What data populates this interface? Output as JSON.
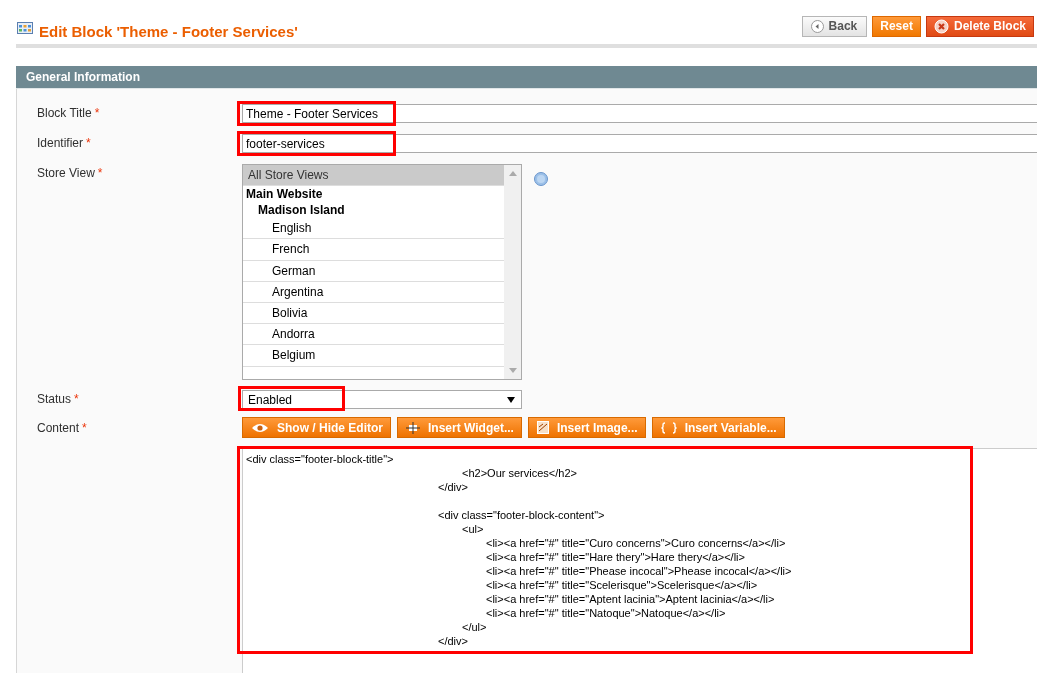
{
  "page_title": "Edit Block 'Theme - Footer Services'",
  "actions": [
    {
      "label": "Back",
      "kind": "back"
    },
    {
      "label": "Reset",
      "kind": "reset"
    },
    {
      "label": "Delete Block",
      "kind": "delete"
    }
  ],
  "section": {
    "title": "General Information"
  },
  "fields": [
    {
      "label": "Block Title",
      "required_mark": "*",
      "kind": "text",
      "value": "Theme - Footer Services",
      "highlighted": true
    },
    {
      "label": "Identifier",
      "required_mark": "*",
      "kind": "text",
      "value": "footer-services",
      "highlighted": true
    },
    {
      "label": "Store View",
      "required_mark": "*",
      "kind": "multiselect",
      "help": true,
      "options": [
        {
          "kind": "option",
          "label": "All Store Views",
          "selected": true
        },
        {
          "kind": "group",
          "label": "Main Website",
          "children": [
            {
              "kind": "group",
              "label": "Madison Island",
              "children": [
                {
                  "kind": "option",
                  "label": "English",
                  "selected": false
                },
                {
                  "kind": "option",
                  "label": "French",
                  "selected": false
                },
                {
                  "kind": "option",
                  "label": "German",
                  "selected": false
                },
                {
                  "kind": "option",
                  "label": "Argentina",
                  "selected": false
                },
                {
                  "kind": "option",
                  "label": "Bolivia",
                  "selected": false
                },
                {
                  "kind": "option",
                  "label": "Andorra",
                  "selected": false
                },
                {
                  "kind": "option",
                  "label": "Belgium",
                  "selected": false
                }
              ]
            }
          ]
        }
      ]
    },
    {
      "label": "Status",
      "required_mark": "*",
      "kind": "select",
      "value": "Enabled",
      "highlighted": true
    },
    {
      "label": "Content",
      "required_mark": "*",
      "kind": "editor",
      "highlighted": true,
      "buttons": [
        {
          "label": "Show / Hide Editor",
          "kind": "eye"
        },
        {
          "label": "Insert Widget...",
          "kind": "widget"
        },
        {
          "label": "Insert Image...",
          "kind": "image"
        },
        {
          "label": "Insert Variable...",
          "kind": "variable"
        }
      ],
      "value": "<div class=\"footer-block-title\">\n\t\t\t\t\t\t\t\t\t<h2>Our services</h2>\n\t\t\t\t\t\t\t\t</div>\n\n\t\t\t\t\t\t\t\t<div class=\"footer-block-content\">\n\t\t\t\t\t\t\t\t\t<ul>\n\t\t\t\t\t\t\t\t\t\t<li><a href=\"#\" title=\"Curo concerns\">Curo concerns</a></li>\n\t\t\t\t\t\t\t\t\t\t<li><a href=\"#\" title=\"Hare thery\">Hare thery</a></li>\n\t\t\t\t\t\t\t\t\t\t<li><a href=\"#\" title=\"Phease incocal\">Phease incocal</a></li>\n\t\t\t\t\t\t\t\t\t\t<li><a href=\"#\" title=\"Scelerisque\">Scelerisque</a></li>\n\t\t\t\t\t\t\t\t\t\t<li><a href=\"#\" title=\"Aptent lacinia\">Aptent lacinia</a></li>\n\t\t\t\t\t\t\t\t\t\t<li><a href=\"#\" title=\"Natoque\">Natoque</a></li>\n\t\t\t\t\t\t\t\t\t</ul>\n\t\t\t\t\t\t\t\t</div>"
    }
  ]
}
